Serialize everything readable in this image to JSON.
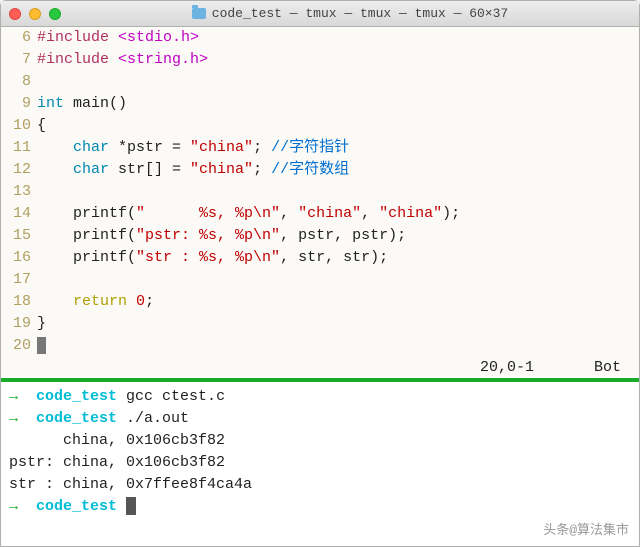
{
  "titlebar": {
    "title": "code_test — tmux — tmux — tmux — 60×37"
  },
  "code": {
    "lines": {
      "l6": {
        "n": "6",
        "pp": "#include ",
        "inc": "<stdio.h>"
      },
      "l7": {
        "n": "7",
        "pp": "#include ",
        "inc": "<string.h>"
      },
      "l8": {
        "n": "8"
      },
      "l9": {
        "n": "9",
        "kw": "int",
        "sp": " ",
        "id": "main()"
      },
      "l10": {
        "n": "10",
        "t": "{"
      },
      "l11": {
        "n": "11",
        "ind": "    ",
        "kw": "char",
        "decl": " *pstr = ",
        "str": "\"china\"",
        "semi": "; ",
        "cmt": "//字符指针"
      },
      "l12": {
        "n": "12",
        "ind": "    ",
        "kw": "char",
        "decl": " str[] = ",
        "str": "\"china\"",
        "semi": "; ",
        "cmt": "//字符数组"
      },
      "l13": {
        "n": "13"
      },
      "l14": {
        "n": "14",
        "ind": "    ",
        "fn": "printf(",
        "s1": "\"      %s, %p\\n\"",
        "m": ", ",
        "s2": "\"china\"",
        "m2": ", ",
        "s3": "\"china\"",
        "end": ");"
      },
      "l15": {
        "n": "15",
        "ind": "    ",
        "fn": "printf(",
        "s1": "\"pstr: %s, %p\\n\"",
        "rest": ", pstr, pstr);"
      },
      "l16": {
        "n": "16",
        "ind": "    ",
        "fn": "printf(",
        "s1": "\"str : %s, %p\\n\"",
        "rest": ", str, str);"
      },
      "l17": {
        "n": "17"
      },
      "l18": {
        "n": "18",
        "ind": "    ",
        "kw": "return",
        "sp": " ",
        "num": "0",
        "semi": ";"
      },
      "l19": {
        "n": "19",
        "t": "}"
      },
      "l20": {
        "n": "20",
        "cursor": " "
      }
    }
  },
  "status": {
    "pos": "20,0-1",
    "loc": "Bot"
  },
  "term": {
    "arrow": "→",
    "dir": "code_test",
    "cmd1": " gcc ctest.c",
    "cmd2": " ./a.out",
    "out1": "      china, 0x106cb3f82",
    "out2": "pstr: china, 0x106cb3f82",
    "out3": "str : china, 0x7ffee8f4ca4a",
    "cmd3": " "
  },
  "watermark": "头条@算法集市"
}
